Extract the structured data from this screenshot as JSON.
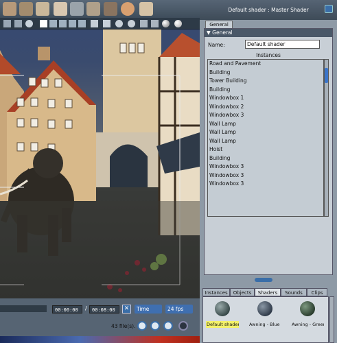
{
  "panel": {
    "title": "Default shader : Master Shader",
    "tab": "General",
    "section": "General",
    "name_label": "Name:",
    "name_value": "Default shader",
    "instances_label": "Instances",
    "instances": [
      "Road and Pavement",
      "Building",
      "Tower Building",
      "Building",
      "Windowbox 1",
      "Windowbox 2",
      "Windowbox 3",
      "Wall Lamp",
      "Wall Lamp",
      "Wall Lamp",
      "Hoist",
      "Building",
      "Windowbox 3",
      "Windowbox 3",
      "Windowbox 3"
    ]
  },
  "library": {
    "tabs": [
      "Instances",
      "Objects",
      "Shaders",
      "Sounds",
      "Clips"
    ],
    "active_tab": "Shaders",
    "items": [
      "Default shader",
      "Awning - Blue S",
      "Awning - Green"
    ]
  },
  "timeline": {
    "time_start": "00:00:00",
    "time_separator": "/",
    "time_end": "00:08:00",
    "mode": "Time",
    "fps": "24 fps",
    "file_count": "43 file(s)."
  },
  "colors": {
    "accent": "#3a6ea8",
    "selected_item": "#f3f16a",
    "panel_bg": "#c8cfd6"
  }
}
